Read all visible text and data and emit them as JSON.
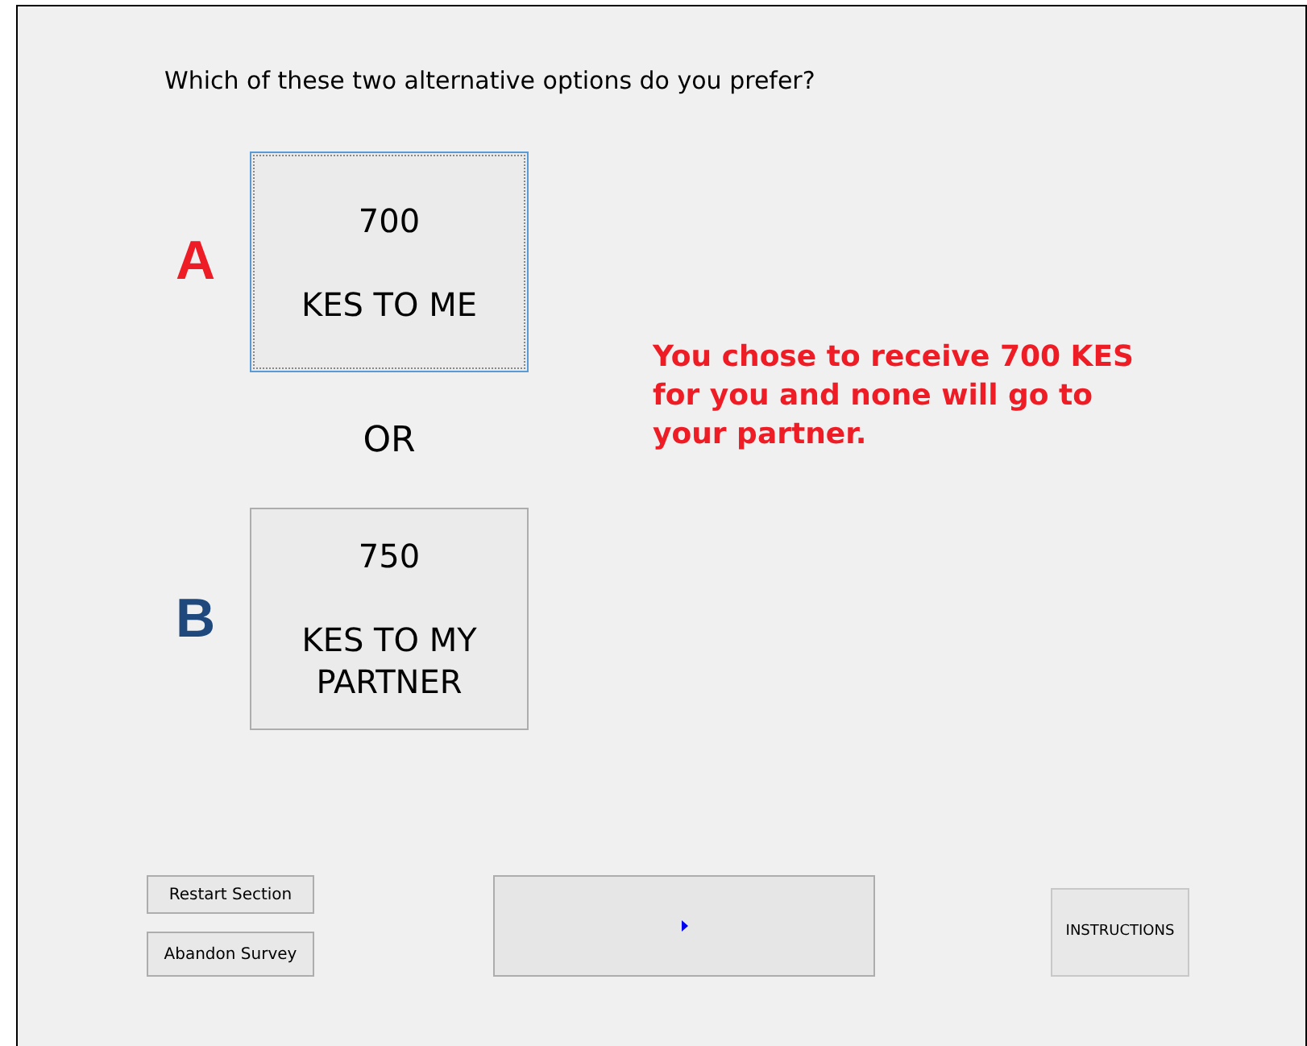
{
  "question": "Which of these two alternative options do you prefer?",
  "options": [
    {
      "letter": "A",
      "amount": "700",
      "label": "KES TO ME",
      "selected": true,
      "color": "#ee1c25"
    },
    {
      "letter": "B",
      "amount": "750",
      "label": "KES TO MY PARTNER",
      "selected": false,
      "color": "#1f497d"
    }
  ],
  "separator": "OR",
  "message": "You chose to receive 700 KES for you and none will go to your partner.",
  "buttons": {
    "restart": "Restart Section",
    "abandon": "Abandon Survey",
    "instructions": "INSTRUCTIONS"
  }
}
